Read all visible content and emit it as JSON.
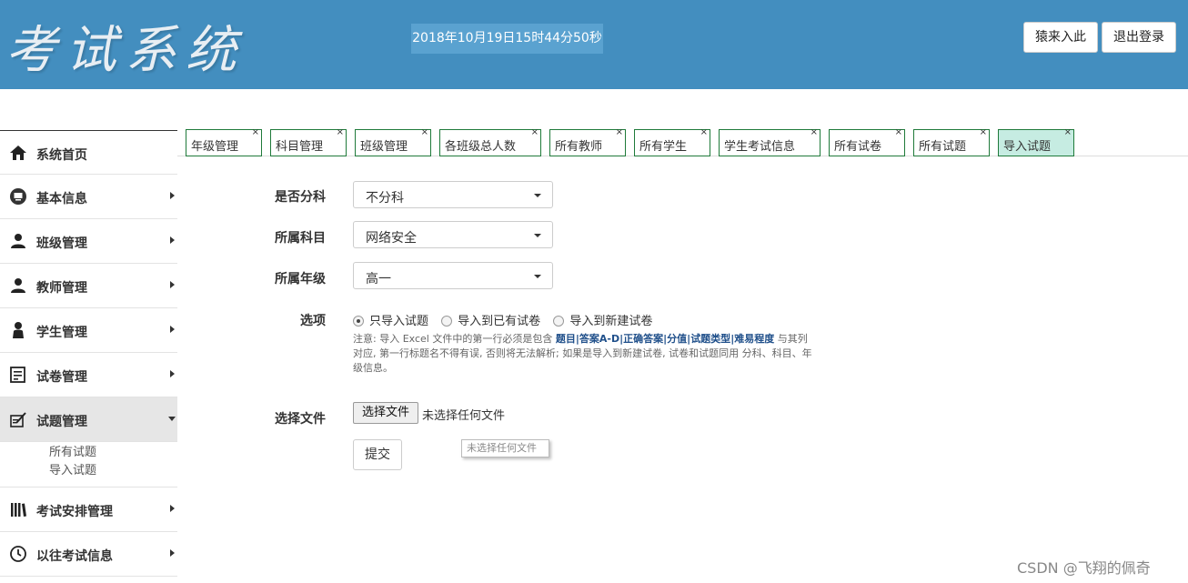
{
  "header": {
    "logo": "考试系统",
    "datetime": "2018年10月19日15时44分50秒",
    "buttons": [
      "猿来入此",
      "退出登录"
    ]
  },
  "sidebar": {
    "items": [
      {
        "label": "系统首页",
        "icon": "home-icon"
      },
      {
        "label": "基本信息",
        "icon": "monitor-icon"
      },
      {
        "label": "班级管理",
        "icon": "users-icon"
      },
      {
        "label": "教师管理",
        "icon": "teacher-icon"
      },
      {
        "label": "学生管理",
        "icon": "student-icon"
      },
      {
        "label": "试卷管理",
        "icon": "paper-icon"
      },
      {
        "label": "试题管理",
        "icon": "question-icon"
      },
      {
        "label": "考试安排管理",
        "icon": "library-icon"
      },
      {
        "label": "以往考试信息",
        "icon": "clock-icon"
      }
    ],
    "sub_items": [
      "所有试题",
      "导入试题"
    ]
  },
  "tabs": [
    "年级管理",
    "科目管理",
    "班级管理",
    "各班级总人数",
    "所有教师",
    "所有学生",
    "学生考试信息",
    "所有试卷",
    "所有试题",
    "导入试题"
  ],
  "tab_close": "×",
  "form": {
    "divide_label": "是否分科",
    "divide_value": "不分科",
    "subject_label": "所属科目",
    "subject_value": "网络安全",
    "grade_label": "所属年级",
    "grade_value": "高一",
    "option_label": "选项",
    "options": [
      "只导入试题",
      "导入到已有试卷",
      "导入到新建试卷"
    ],
    "note_prefix": "注意: 导入 Excel 文件中的第一行必须是包含 ",
    "note_fields": [
      "题目",
      "答案A-D",
      "正确答案",
      "分值",
      "试题类型",
      "难易程度"
    ],
    "note_suffix": " 与其列对应, 第一行标题名不得有误, 否则将无法解析; 如果是导入到新建试卷, 试卷和试题同用 分科、科目、年级信息。",
    "file_label": "选择文件",
    "file_button": "选择文件",
    "file_status": "未选择任何文件",
    "submit": "提交",
    "tooltip": "未选择任何文件"
  },
  "watermark": "CSDN @飞翔的佩奇"
}
